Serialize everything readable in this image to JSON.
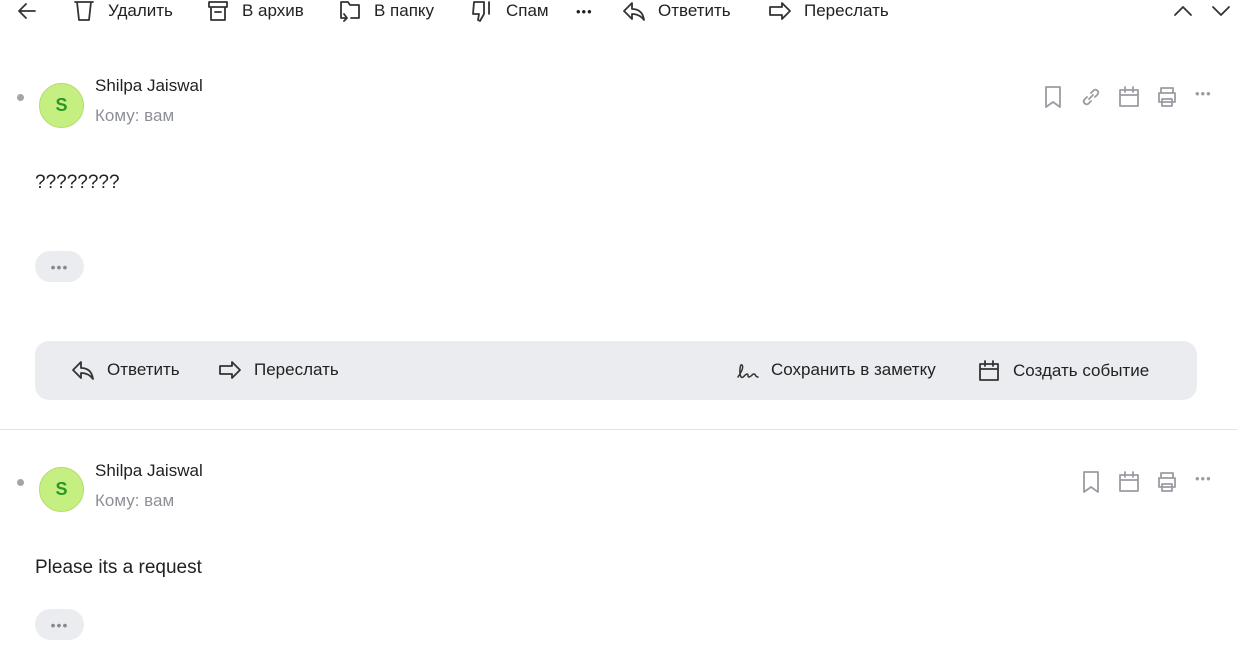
{
  "toolbar": {
    "delete": "Удалить",
    "archive": "В архив",
    "folder": "В папку",
    "spam": "Спам",
    "more": "•••",
    "reply": "Ответить",
    "forward": "Переслать"
  },
  "messages": [
    {
      "avatar_letter": "S",
      "sender": "Shilpa Jaiswal",
      "to": "Кому: вам",
      "body": "????????",
      "expand": "•••"
    },
    {
      "avatar_letter": "S",
      "sender": "Shilpa Jaiswal",
      "to": "Кому: вам",
      "body": "Please its a request",
      "expand": "•••"
    }
  ],
  "action_bar": {
    "reply": "Ответить",
    "forward": "Переслать",
    "save_note": "Сохранить в заметку",
    "create_event": "Создать событие"
  },
  "colors": {
    "avatar_bg": "#c6ef82",
    "avatar_text": "#2b962b",
    "bar_bg": "#ebecf0"
  }
}
